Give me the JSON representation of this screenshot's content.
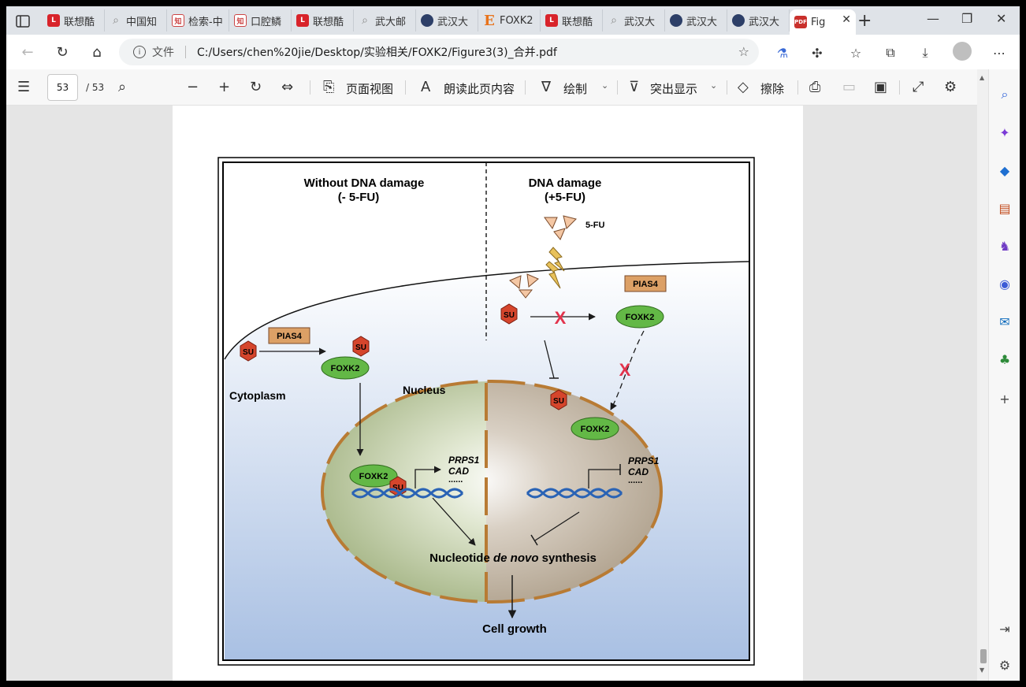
{
  "tabs": [
    {
      "label": "联想酷",
      "icon": "lenovo-icon"
    },
    {
      "label": "中国知",
      "icon": "search-icon"
    },
    {
      "label": "检索-中",
      "icon": "cnki-icon"
    },
    {
      "label": "口腔鳞",
      "icon": "cnki-icon"
    },
    {
      "label": "联想酷",
      "icon": "lenovo-icon"
    },
    {
      "label": "武大邮",
      "icon": "search-icon"
    },
    {
      "label": "武汉大",
      "icon": "whu-seal-icon"
    },
    {
      "label": "FOXK2",
      "icon": "elsevier-icon"
    },
    {
      "label": "联想酷",
      "icon": "lenovo-icon"
    },
    {
      "label": "武汉大",
      "icon": "search-icon"
    },
    {
      "label": "武汉大",
      "icon": "whu-seal-icon"
    },
    {
      "label": "武汉大",
      "icon": "whu-seal-icon"
    },
    {
      "label": "Fig",
      "icon": "pdf-icon",
      "active": true
    }
  ],
  "address": {
    "scheme": "文件",
    "url": "C:/Users/chen%20jie/Desktop/实验相关/FOXK2/Figure3(3)_合并.pdf"
  },
  "pdf_toolbar": {
    "page_current": "53",
    "page_total": "/ 53",
    "page_view": "页面视图",
    "read_aloud": "朗读此页内容",
    "draw": "绘制",
    "highlight": "突出显示",
    "erase": "擦除"
  },
  "figure": {
    "left_title": "Without DNA damage",
    "left_subtitle": "(- 5-FU)",
    "right_title": "DNA damage",
    "right_subtitle": "(+5-FU)",
    "fu_label": "5-FU",
    "pias4": "PIAS4",
    "su": "SU",
    "foxk2": "FOXK2",
    "cytoplasm": "Cytoplasm",
    "nucleus": "Nucleus",
    "gene1": "PRPS1",
    "gene2": "CAD",
    "dots": "......",
    "synthesis_pre": "Nucleotide ",
    "synthesis_it": "de novo",
    "synthesis_post": " synthesis",
    "cell_growth": "Cell growth",
    "block_mark": "X"
  },
  "colors": {
    "su_red": "#d5452c",
    "foxk2_green": "#63b846",
    "pias4_tan": "#dca066",
    "dna_blue": "#2a63b5",
    "membrane_brown": "#b87b34",
    "block_red": "#e2334c"
  }
}
